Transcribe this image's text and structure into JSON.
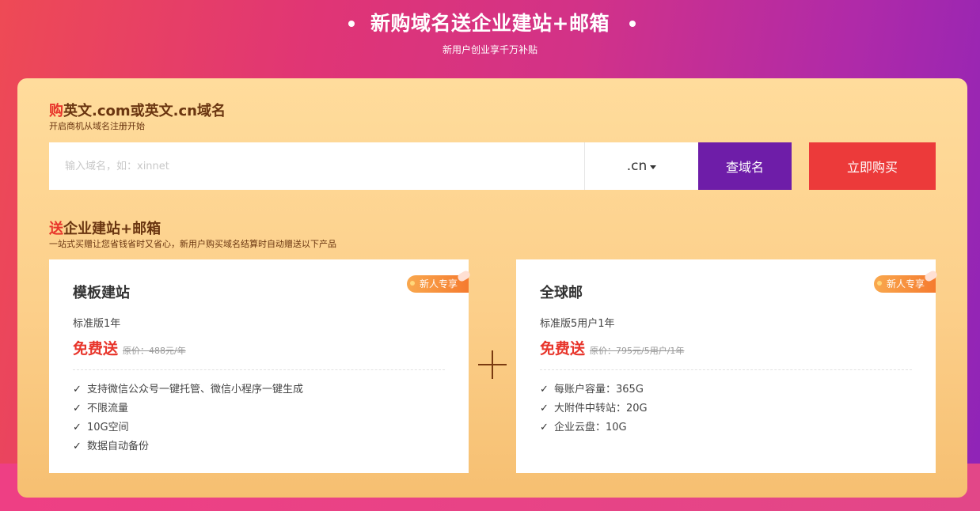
{
  "hero": {
    "title": "新购域名送企业建站+邮箱",
    "subtitle": "新用户创业享千万补贴"
  },
  "domain_section": {
    "title_highlight": "购",
    "title_rest": "英文.com或英文.cn域名",
    "subtitle": "开启商机从域名注册开始",
    "search_placeholder": "输入域名，如：xinnet",
    "suffix_selected": ".cn",
    "query_button": "查域名",
    "buy_button": "立即购买"
  },
  "gift_section": {
    "title_highlight": "送",
    "title_rest": "企业建站+邮箱",
    "subtitle": "一站式买赠让您省钱省时又省心，新用户购买域名结算时自动赠送以下产品"
  },
  "cards": [
    {
      "badge": "新人专享",
      "title": "模板建站",
      "spec": "标准版1年",
      "free_label": "免费送",
      "original_price": "原价：488元/年",
      "features": [
        "支持微信公众号一键托管、微信小程序一键生成",
        "不限流量",
        "10G空间",
        "数据自动备份"
      ]
    },
    {
      "badge": "新人专享",
      "title": "全球邮",
      "spec": "标准版5用户1年",
      "free_label": "免费送",
      "original_price": "原价：795元/5用户/1年",
      "features": [
        "每账户容量：365G",
        "大附件中转站：20G",
        "企业云盘：10G"
      ]
    }
  ],
  "check_glyph": "✓",
  "colors": {
    "accent_red": "#e8352b",
    "query_purple": "#6e1da8",
    "buy_red": "#ec3a3a",
    "badge_orange": "#f57b2f"
  }
}
